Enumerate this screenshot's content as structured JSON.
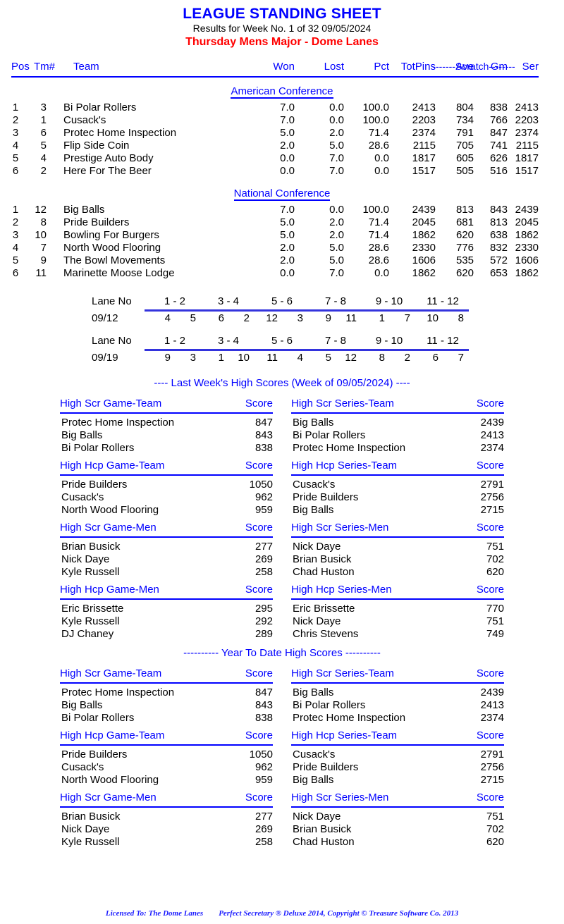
{
  "header": {
    "title": "LEAGUE STANDING SHEET",
    "subtitle": "Results for Week No. 1 of 32    09/05/2024",
    "league": "Thursday Mens Major - Dome Lanes"
  },
  "standings": {
    "scratch_label": "-------Scratch--------",
    "columns": {
      "pos": "Pos",
      "tm": "Tm#",
      "team": "Team",
      "won": "Won",
      "lost": "Lost",
      "pct": "Pct",
      "totpins": "TotPins",
      "ave": "Ave",
      "gm": "Gm",
      "ser": "Ser"
    },
    "conferences": [
      {
        "name": "American Conference",
        "rows": [
          {
            "pos": "1",
            "tm": "3",
            "team": "Bi Polar Rollers",
            "won": "7.0",
            "lost": "0.0",
            "pct": "100.0",
            "totpins": "2413",
            "ave": "804",
            "gm": "838",
            "ser": "2413"
          },
          {
            "pos": "2",
            "tm": "1",
            "team": "Cusack's",
            "won": "7.0",
            "lost": "0.0",
            "pct": "100.0",
            "totpins": "2203",
            "ave": "734",
            "gm": "766",
            "ser": "2203"
          },
          {
            "pos": "3",
            "tm": "6",
            "team": "Protec Home Inspection",
            "won": "5.0",
            "lost": "2.0",
            "pct": "71.4",
            "totpins": "2374",
            "ave": "791",
            "gm": "847",
            "ser": "2374"
          },
          {
            "pos": "4",
            "tm": "5",
            "team": "Flip Side Coin",
            "won": "2.0",
            "lost": "5.0",
            "pct": "28.6",
            "totpins": "2115",
            "ave": "705",
            "gm": "741",
            "ser": "2115"
          },
          {
            "pos": "5",
            "tm": "4",
            "team": "Prestige Auto Body",
            "won": "0.0",
            "lost": "7.0",
            "pct": "0.0",
            "totpins": "1817",
            "ave": "605",
            "gm": "626",
            "ser": "1817"
          },
          {
            "pos": "6",
            "tm": "2",
            "team": "Here For The Beer",
            "won": "0.0",
            "lost": "7.0",
            "pct": "0.0",
            "totpins": "1517",
            "ave": "505",
            "gm": "516",
            "ser": "1517"
          }
        ]
      },
      {
        "name": "National Conference",
        "rows": [
          {
            "pos": "1",
            "tm": "12",
            "team": "Big Balls",
            "won": "7.0",
            "lost": "0.0",
            "pct": "100.0",
            "totpins": "2439",
            "ave": "813",
            "gm": "843",
            "ser": "2439"
          },
          {
            "pos": "2",
            "tm": "8",
            "team": "Pride Builders",
            "won": "5.0",
            "lost": "2.0",
            "pct": "71.4",
            "totpins": "2045",
            "ave": "681",
            "gm": "813",
            "ser": "2045"
          },
          {
            "pos": "3",
            "tm": "10",
            "team": "Bowling For Burgers",
            "won": "5.0",
            "lost": "2.0",
            "pct": "71.4",
            "totpins": "1862",
            "ave": "620",
            "gm": "638",
            "ser": "1862"
          },
          {
            "pos": "4",
            "tm": "7",
            "team": "North Wood Flooring",
            "won": "2.0",
            "lost": "5.0",
            "pct": "28.6",
            "totpins": "2330",
            "ave": "776",
            "gm": "832",
            "ser": "2330"
          },
          {
            "pos": "5",
            "tm": "9",
            "team": "The Bowl Movements",
            "won": "2.0",
            "lost": "5.0",
            "pct": "28.6",
            "totpins": "1606",
            "ave": "535",
            "gm": "572",
            "ser": "1606"
          },
          {
            "pos": "6",
            "tm": "11",
            "team": "Marinette Moose Lodge",
            "won": "0.0",
            "lost": "7.0",
            "pct": "0.0",
            "totpins": "1862",
            "ave": "620",
            "gm": "653",
            "ser": "1862"
          }
        ]
      }
    ]
  },
  "lane_schedule": {
    "label": "Lane No",
    "blocks": [
      {
        "date": "09/12",
        "pairs": [
          "1 - 2",
          "3 - 4",
          "5 - 6",
          "7 - 8",
          "9 - 10",
          "11 - 12"
        ],
        "teams": [
          [
            "4",
            "5"
          ],
          [
            "6",
            "2"
          ],
          [
            "12",
            "3"
          ],
          [
            "9",
            "11"
          ],
          [
            "1",
            "7"
          ],
          [
            "10",
            "8"
          ]
        ]
      },
      {
        "date": "09/19",
        "pairs": [
          "1 - 2",
          "3 - 4",
          "5 - 6",
          "7 - 8",
          "9 - 10",
          "11 - 12"
        ],
        "teams": [
          [
            "9",
            "3"
          ],
          [
            "1",
            "10"
          ],
          [
            "11",
            "4"
          ],
          [
            "5",
            "12"
          ],
          [
            "8",
            "2"
          ],
          [
            "6",
            "7"
          ]
        ]
      }
    ]
  },
  "last_week": {
    "section_title": "----  Last Week's High Scores   (Week of 09/05/2024)  ----",
    "score_label": "Score",
    "blocks": [
      {
        "left": {
          "header": "High Scr Game-Team",
          "rows": [
            {
              "name": "Protec Home Inspection",
              "score": "847"
            },
            {
              "name": "Big Balls",
              "score": "843"
            },
            {
              "name": "Bi Polar Rollers",
              "score": "838"
            }
          ]
        },
        "right": {
          "header": "High Scr Series-Team",
          "rows": [
            {
              "name": "Big Balls",
              "score": "2439"
            },
            {
              "name": "Bi Polar Rollers",
              "score": "2413"
            },
            {
              "name": "Protec Home Inspection",
              "score": "2374"
            }
          ]
        }
      },
      {
        "left": {
          "header": "High Hcp Game-Team",
          "rows": [
            {
              "name": "Pride Builders",
              "score": "1050"
            },
            {
              "name": "Cusack's",
              "score": "962"
            },
            {
              "name": "North Wood Flooring",
              "score": "959"
            }
          ]
        },
        "right": {
          "header": "High Hcp Series-Team",
          "rows": [
            {
              "name": "Cusack's",
              "score": "2791"
            },
            {
              "name": "Pride Builders",
              "score": "2756"
            },
            {
              "name": "Big Balls",
              "score": "2715"
            }
          ]
        }
      },
      {
        "left": {
          "header": "High Scr Game-Men",
          "rows": [
            {
              "name": "Brian Busick",
              "score": "277"
            },
            {
              "name": "Nick Daye",
              "score": "269"
            },
            {
              "name": "Kyle Russell",
              "score": "258"
            }
          ]
        },
        "right": {
          "header": "High Scr Series-Men",
          "rows": [
            {
              "name": "Nick Daye",
              "score": "751"
            },
            {
              "name": "Brian Busick",
              "score": "702"
            },
            {
              "name": "Chad Huston",
              "score": "620"
            }
          ]
        }
      },
      {
        "left": {
          "header": "High Hcp Game-Men",
          "rows": [
            {
              "name": "Eric Brissette",
              "score": "295"
            },
            {
              "name": "Kyle Russell",
              "score": "292"
            },
            {
              "name": "DJ Chaney",
              "score": "289"
            }
          ]
        },
        "right": {
          "header": "High Hcp Series-Men",
          "rows": [
            {
              "name": "Eric Brissette",
              "score": "770"
            },
            {
              "name": "Nick Daye",
              "score": "751"
            },
            {
              "name": "Chris Stevens",
              "score": "749"
            }
          ]
        }
      }
    ]
  },
  "year_to_date": {
    "section_title": "---------- Year To Date High Scores ----------",
    "score_label": "Score",
    "blocks": [
      {
        "left": {
          "header": "High Scr Game-Team",
          "rows": [
            {
              "name": "Protec Home Inspection",
              "score": "847"
            },
            {
              "name": "Big Balls",
              "score": "843"
            },
            {
              "name": "Bi Polar Rollers",
              "score": "838"
            }
          ]
        },
        "right": {
          "header": "High Scr Series-Team",
          "rows": [
            {
              "name": "Big Balls",
              "score": "2439"
            },
            {
              "name": "Bi Polar Rollers",
              "score": "2413"
            },
            {
              "name": "Protec Home Inspection",
              "score": "2374"
            }
          ]
        }
      },
      {
        "left": {
          "header": "High Hcp Game-Team",
          "rows": [
            {
              "name": "Pride Builders",
              "score": "1050"
            },
            {
              "name": "Cusack's",
              "score": "962"
            },
            {
              "name": "North Wood Flooring",
              "score": "959"
            }
          ]
        },
        "right": {
          "header": "High Hcp Series-Team",
          "rows": [
            {
              "name": "Cusack's",
              "score": "2791"
            },
            {
              "name": "Pride Builders",
              "score": "2756"
            },
            {
              "name": "Big Balls",
              "score": "2715"
            }
          ]
        }
      },
      {
        "left": {
          "header": "High Scr Game-Men",
          "rows": [
            {
              "name": "Brian Busick",
              "score": "277"
            },
            {
              "name": "Nick Daye",
              "score": "269"
            },
            {
              "name": "Kyle Russell",
              "score": "258"
            }
          ]
        },
        "right": {
          "header": "High Scr Series-Men",
          "rows": [
            {
              "name": "Nick Daye",
              "score": "751"
            },
            {
              "name": "Brian Busick",
              "score": "702"
            },
            {
              "name": "Chad Huston",
              "score": "620"
            }
          ]
        }
      }
    ]
  },
  "footer": {
    "licensed_to": "Licensed To: The Dome Lanes",
    "product": "Perfect Secretary ® Deluxe  2014, Copyright © Treasure Software Co. 2013"
  },
  "colors": {
    "accent_blue": "#0000ff",
    "league_red": "#ff0000",
    "text_black": "#000000",
    "rule_blue": "#3333dd"
  }
}
